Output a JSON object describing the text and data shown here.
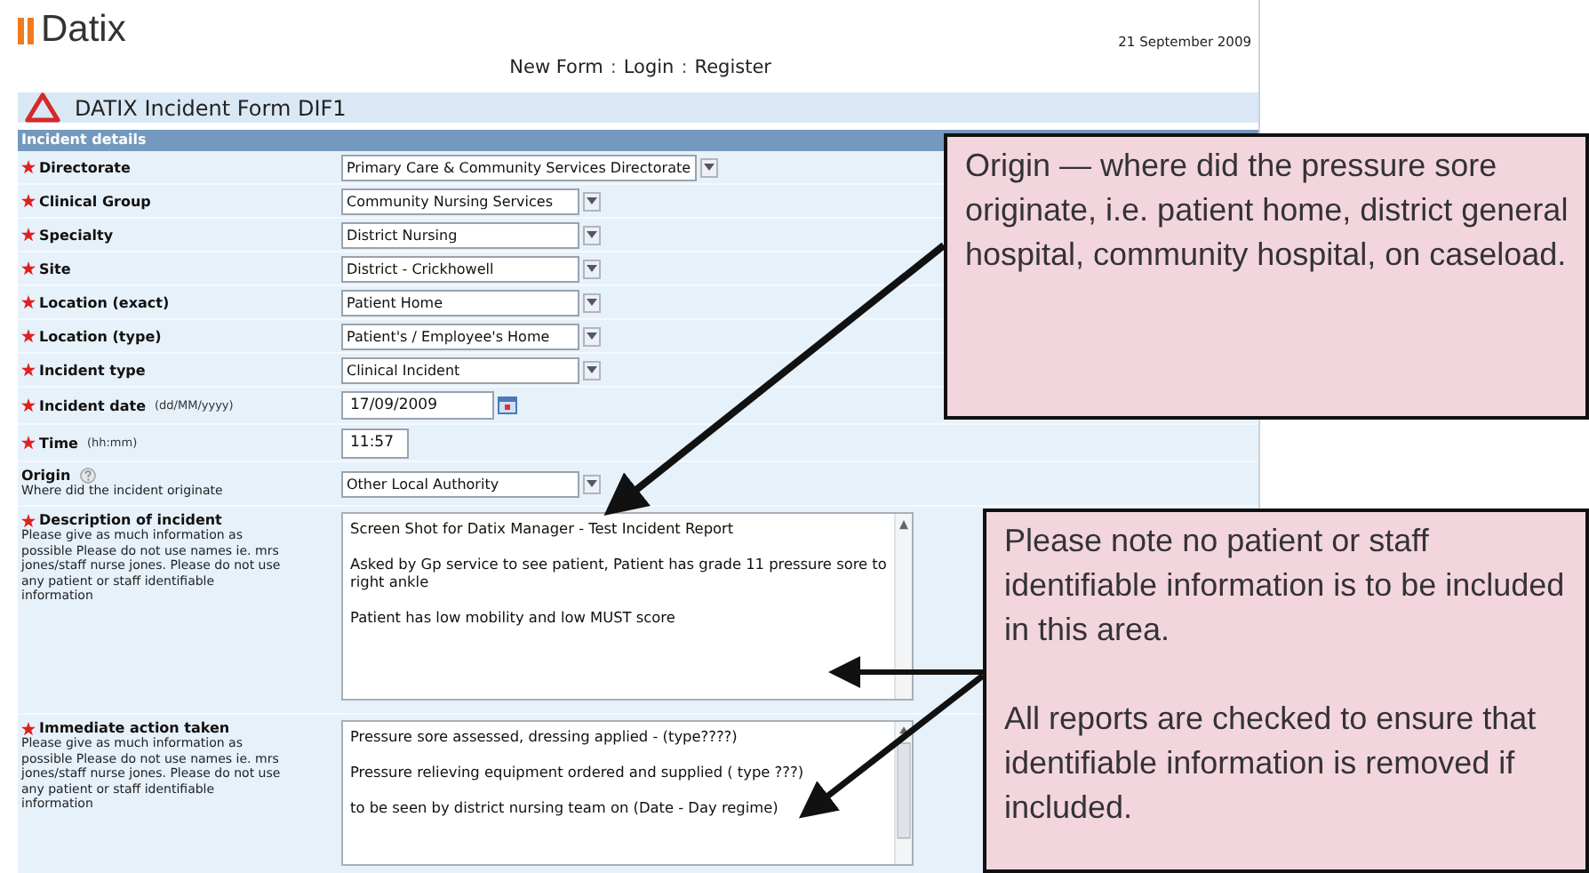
{
  "header": {
    "logo": "Datix",
    "date": "21 September 2009"
  },
  "nav": [
    {
      "kind": "link",
      "text": "New Form"
    },
    {
      "kind": "separator",
      "text": ":"
    },
    {
      "kind": "link",
      "text": "Login"
    },
    {
      "kind": "separator",
      "text": ":"
    },
    {
      "kind": "link",
      "text": "Register"
    }
  ],
  "form": {
    "title": "DATIX Incident Form DIF1",
    "section": "Incident details",
    "fields": [
      {
        "kind": "select",
        "label": "Directorate",
        "required": true,
        "value": "Primary Care & Community Services Directorate"
      },
      {
        "kind": "select",
        "label": "Clinical Group",
        "required": true,
        "value": "Community Nursing Services"
      },
      {
        "kind": "select",
        "label": "Specialty",
        "required": true,
        "value": "District Nursing"
      },
      {
        "kind": "select",
        "label": "Site",
        "required": true,
        "value": "District - Crickhowell"
      },
      {
        "kind": "select",
        "label": "Location (exact)",
        "required": true,
        "value": "Patient Home"
      },
      {
        "kind": "select",
        "label": "Location (type)",
        "required": true,
        "value": "Patient's / Employee's Home"
      },
      {
        "kind": "select",
        "label": "Incident type",
        "required": true,
        "value": "Clinical Incident"
      },
      {
        "kind": "date",
        "label": "Incident date",
        "format": "(dd/MM/yyyy)",
        "required": true,
        "value": "17/09/2009"
      },
      {
        "kind": "time",
        "label": "Time",
        "format": "(hh:mm)",
        "required": true,
        "value": "11:57"
      },
      {
        "kind": "select",
        "label": "Origin",
        "required": false,
        "help": true,
        "hint": "Where did the incident originate",
        "value": "Other Local Authority"
      },
      {
        "kind": "textarea",
        "label": "Description of incident",
        "required": true,
        "hint": "Please give as much information as possible Please do not use names ie. mrs jones/staff nurse jones. Please do not use any patient or staff identifiable information",
        "lines": [
          "Screen Shot for Datix Manager - Test Incident Report",
          "Asked by Gp service to see patient, Patient has grade 11 pressure sore to right ankle",
          "Patient has low mobility and low MUST score"
        ]
      },
      {
        "kind": "textarea",
        "label": "Immediate action taken",
        "required": true,
        "hint": "Please give as much information as possible Please do not use names ie. mrs jones/staff nurse jones. Please do not use any patient or staff identifiable information",
        "lines": [
          "Pressure sore assessed, dressing applied - (type????)",
          "Pressure relieving equipment ordered and supplied ( type ???)",
          "to be seen by district nursing team on (Date - Day regime)"
        ]
      }
    ]
  },
  "callouts": [
    {
      "paragraphs": [
        "Origin — where did the pressure sore originate, i.e. patient home, district general hospital, community hospital, on caseload."
      ]
    },
    {
      "paragraphs": [
        "Please note no patient or staff identifiable information is to be included in this area.",
        "All reports are checked to ensure that identifiable information is removed if included."
      ]
    }
  ]
}
